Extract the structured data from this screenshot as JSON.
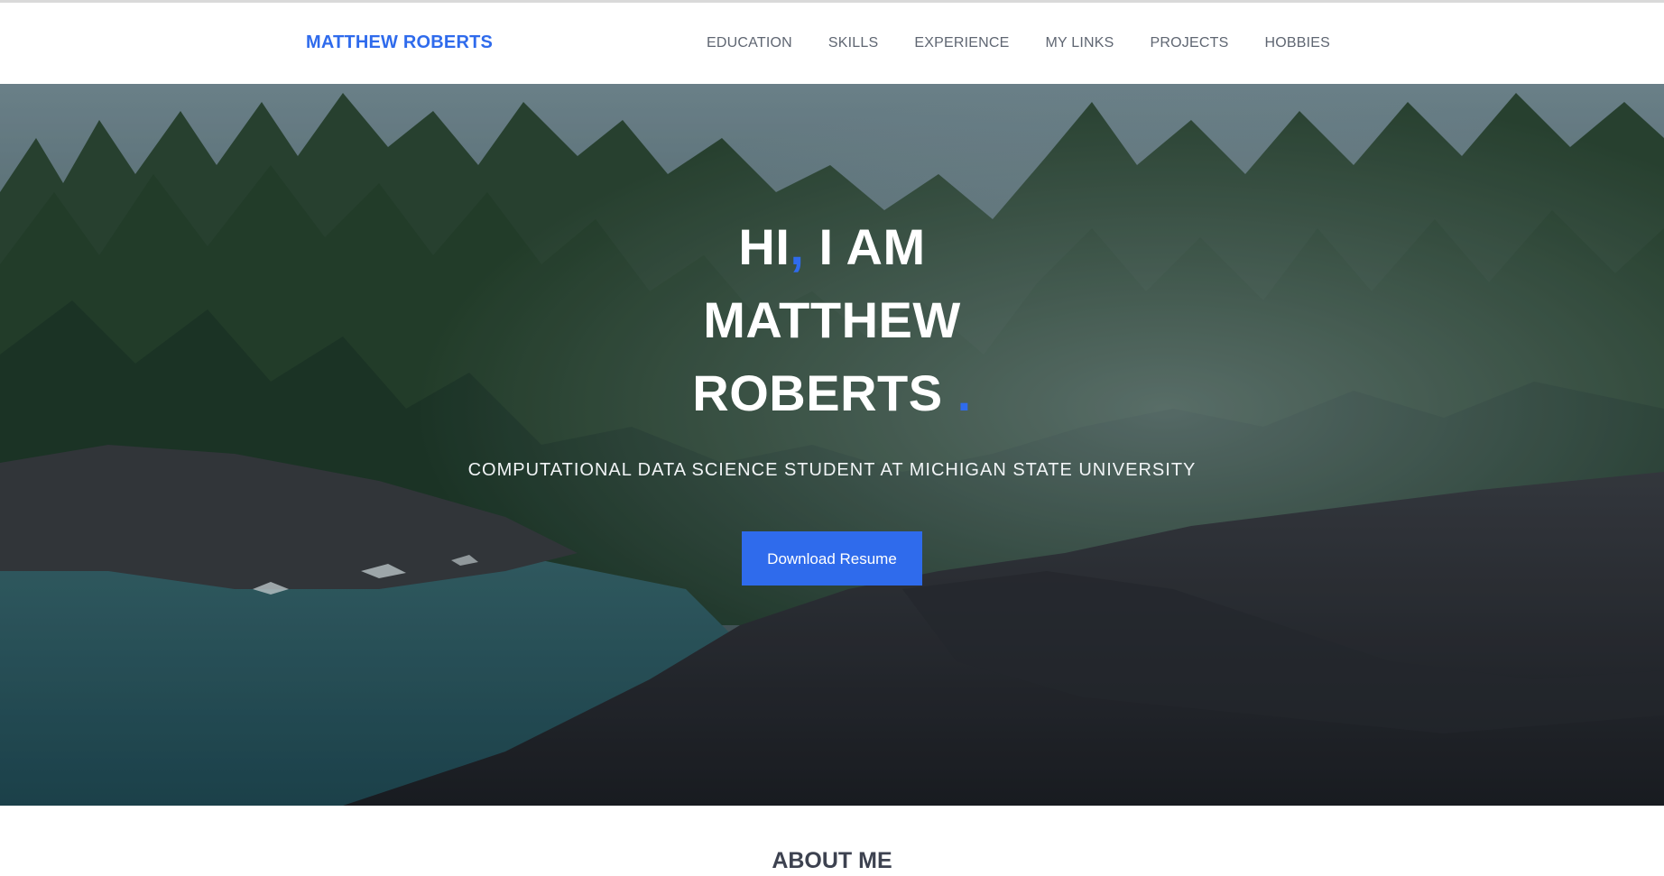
{
  "navbar": {
    "brand": "MATTHEW ROBERTS",
    "links": [
      {
        "label": "EDUCATION"
      },
      {
        "label": "SKILLS"
      },
      {
        "label": "EXPERIENCE"
      },
      {
        "label": "MY LINKS"
      },
      {
        "label": "PROJECTS"
      },
      {
        "label": "HOBBIES"
      }
    ]
  },
  "hero": {
    "title": {
      "part1": "HI",
      "comma": ",",
      "part2": " I AM",
      "line2": "MATTHEW",
      "line3": "ROBERTS ",
      "period": "."
    },
    "subtitle": "COMPUTATIONAL DATA SCIENCE STUDENT AT MICHIGAN STATE UNIVERSITY",
    "button_label": "Download Resume",
    "background": "forest-lake-rocks-photo"
  },
  "about": {
    "heading": "ABOUT ME"
  },
  "colors": {
    "accent": "#2f6bec",
    "nav_text": "#5f6672",
    "heading_text": "#3d4250"
  }
}
